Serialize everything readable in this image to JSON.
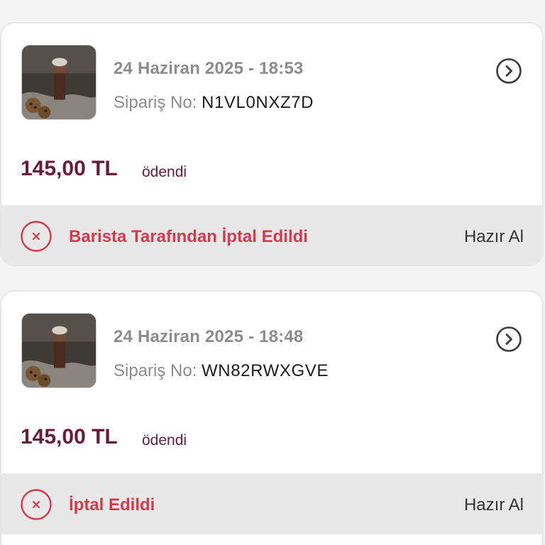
{
  "orders": [
    {
      "thumbnail_icon": "iced-mocha-drink-photo",
      "date": "24 Haziran 2025 - 18:53",
      "order_no_label": "Sipariş No:",
      "order_no": "N1VL0NXZ7D",
      "price": "145,00 TL",
      "payment_status": "ödendi",
      "status": "Barista Tarafından İptal Edildi",
      "delivery_type": "Hazır Al"
    },
    {
      "thumbnail_icon": "iced-mocha-drink-photo",
      "date": "24 Haziran 2025 - 18:48",
      "order_no_label": "Sipariş No:",
      "order_no": "WN82RWXGVE",
      "price": "145,00 TL",
      "payment_status": "ödendi",
      "status": "İptal Edildi",
      "delivery_type": "Hazır Al"
    }
  ],
  "colors": {
    "price": "#6a1a3d",
    "cancel_status": "#d63a4a",
    "muted_text": "#8c8c8c",
    "status_bar_bg": "#e8e8e8"
  }
}
